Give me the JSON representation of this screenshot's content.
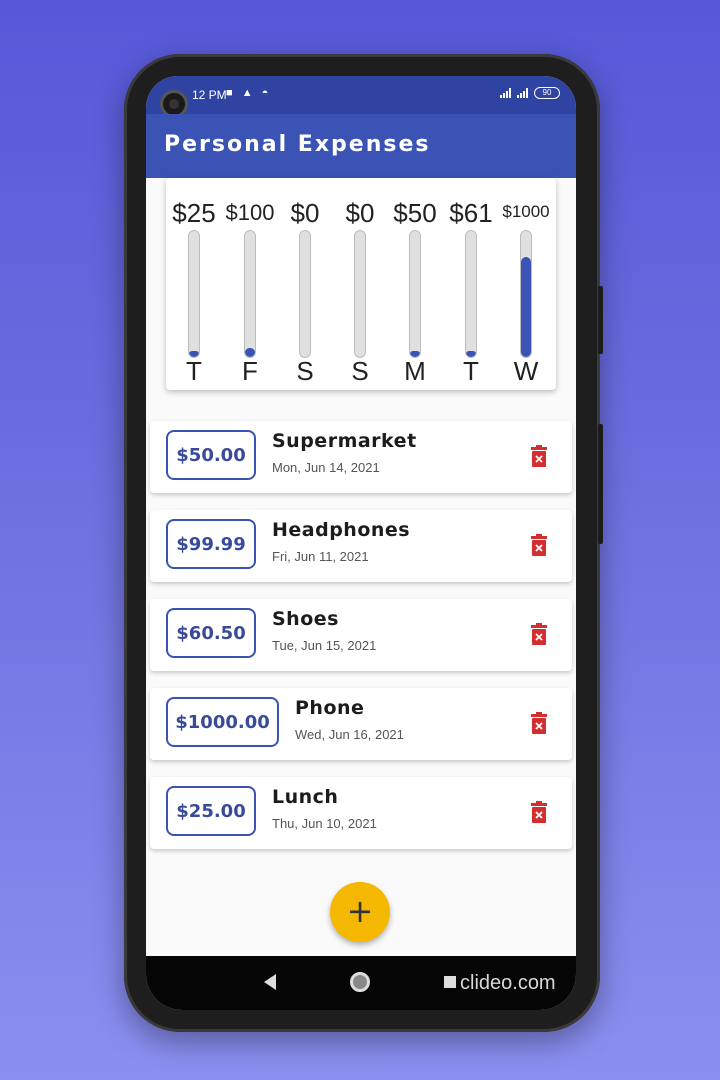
{
  "status_bar": {
    "time": "12 PM",
    "icons": "■ ▲ ◓",
    "battery": "90"
  },
  "app_bar": {
    "title": "Personal Expenses"
  },
  "chart": {
    "bars": [
      {
        "amount": "$25",
        "day": "T",
        "fill": 0.02
      },
      {
        "amount": "$100",
        "day": "F",
        "fill": 0.07
      },
      {
        "amount": "$0",
        "day": "S",
        "fill": 0.0
      },
      {
        "amount": "$0",
        "day": "S",
        "fill": 0.0
      },
      {
        "amount": "$50",
        "day": "M",
        "fill": 0.04
      },
      {
        "amount": "$61",
        "day": "T",
        "fill": 0.05
      },
      {
        "amount": "$1000",
        "day": "W",
        "fill": 0.79
      }
    ]
  },
  "transactions": [
    {
      "amount": "$50.00",
      "title": "Supermarket",
      "date": "Mon, Jun 14, 2021"
    },
    {
      "amount": "$99.99",
      "title": "Headphones",
      "date": "Fri, Jun 11, 2021"
    },
    {
      "amount": "$60.50",
      "title": "Shoes",
      "date": "Tue, Jun 15, 2021"
    },
    {
      "amount": "$1000.00",
      "title": "Phone",
      "date": "Wed, Jun 16, 2021"
    },
    {
      "amount": "$25.00",
      "title": "Lunch",
      "date": "Thu, Jun 10, 2021"
    }
  ],
  "fab": {
    "label": "+"
  },
  "watermark": "clideo.com",
  "colors": {
    "primary": "#3a53b4",
    "accent": "#f5b800",
    "delete": "#d32f2f"
  },
  "icons": {
    "delete": "trash-icon",
    "back": "back-icon",
    "home": "home-icon",
    "recent": "recent-apps-icon"
  }
}
